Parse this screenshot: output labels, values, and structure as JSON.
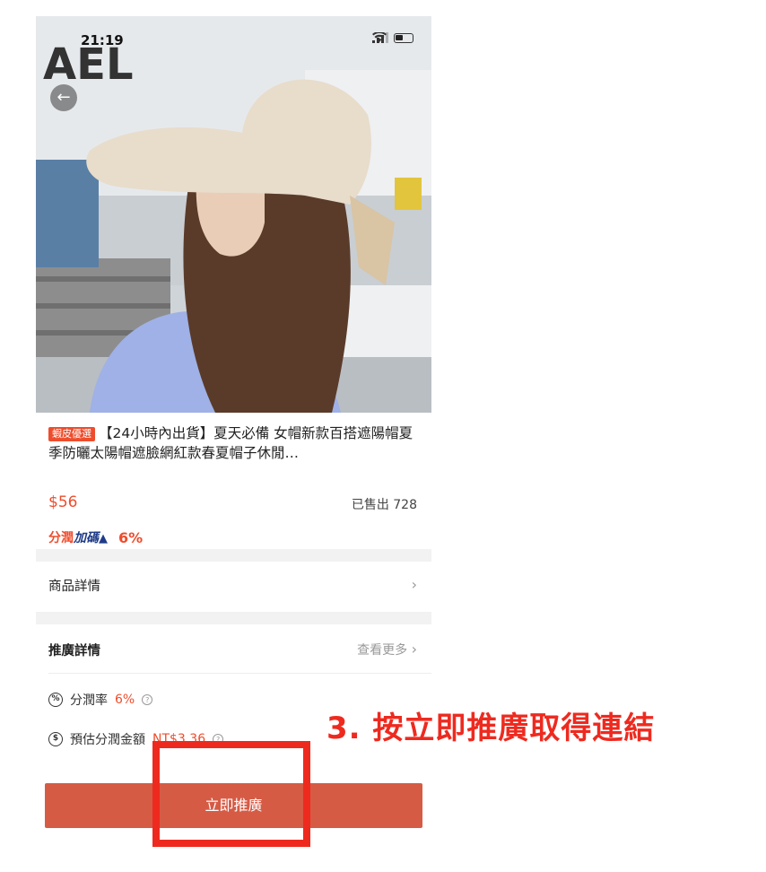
{
  "status_bar": {
    "time": "21:19"
  },
  "icons": {
    "back": "back-arrow-icon"
  },
  "product": {
    "badge": "蝦皮優選",
    "title": "【24小時內出貨】夏天必備 女帽新款百搭遮陽帽夏季防曬太陽帽遮臉網紅款春夏帽子休閒…",
    "price": "$56",
    "sold": "已售出 728",
    "commission_label_a": "分潤",
    "commission_label_b": "加碼",
    "commission_rate": "6%"
  },
  "sections": {
    "product_details": "商品詳情",
    "promo_details": "推廣詳情",
    "see_more": "查看更多"
  },
  "stats": {
    "commission_rate_label": "分潤率",
    "commission_rate_value": "6%",
    "estimated_label": "預估分潤金額",
    "estimated_value": "NT$3.36"
  },
  "cta": {
    "label": "立即推廣"
  },
  "annotation": {
    "text": "3. 按立即推廣取得連結"
  },
  "colors": {
    "accent": "#ee4d2d",
    "cta": "#d65b45",
    "annotation": "#ee2a1f"
  }
}
